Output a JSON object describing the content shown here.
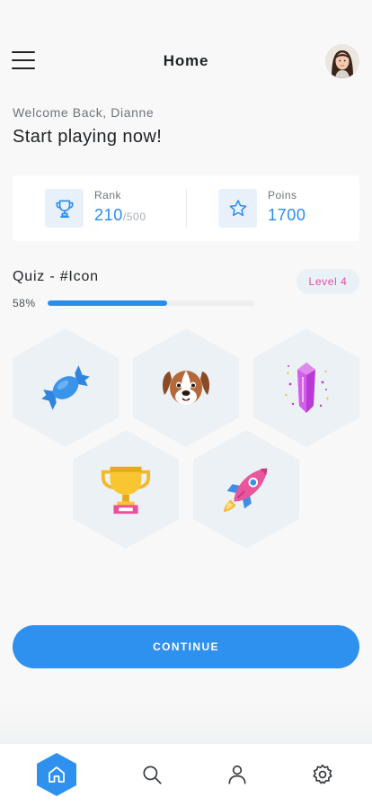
{
  "header": {
    "title": "Home",
    "menu_icon": "hamburger-menu-icon",
    "avatar_icon": "user-avatar"
  },
  "welcome": {
    "greeting": "Welcome Back, Dianne",
    "headline": "Start playing now!"
  },
  "stats": {
    "rank": {
      "label": "Rank",
      "value": "210",
      "total": "/500",
      "icon": "trophy-outline-icon"
    },
    "points": {
      "label": "Poins",
      "value": "1700",
      "icon": "star-outline-icon"
    }
  },
  "quiz": {
    "title": "Quiz - #Icon",
    "level": "Level 4",
    "progress_text": "58%",
    "progress_fraction": 0.58
  },
  "icons": [
    {
      "name": "candy-icon"
    },
    {
      "name": "dog-icon"
    },
    {
      "name": "crystal-icon"
    },
    {
      "name": "trophy-icon"
    },
    {
      "name": "rocket-icon"
    }
  ],
  "continue_label": "CONTINUE",
  "nav": {
    "items": [
      {
        "name": "home-icon",
        "active": true
      },
      {
        "name": "search-icon",
        "active": false
      },
      {
        "name": "profile-icon",
        "active": false
      },
      {
        "name": "settings-icon",
        "active": false
      }
    ]
  },
  "colors": {
    "accent": "#2e91ef",
    "accent_text": "#2a8de9",
    "level_pink": "#e64ea1",
    "hex_bg": "#ecf1f6",
    "background": "#f8f8f8"
  }
}
